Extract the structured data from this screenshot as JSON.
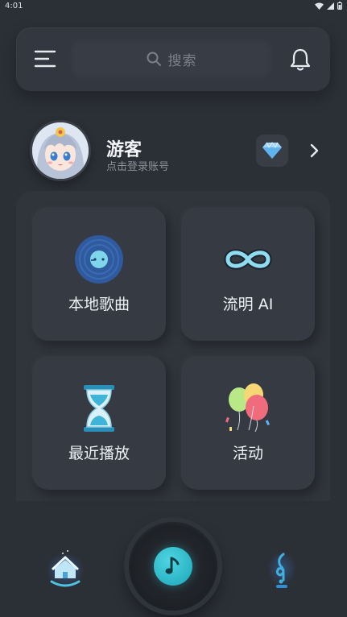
{
  "status_bar": {
    "time": "4:01"
  },
  "header": {
    "search_placeholder": "搜索"
  },
  "profile": {
    "name": "游客",
    "hint": "点击登录账号"
  },
  "tiles": [
    {
      "label": "本地歌曲",
      "icon": "vinyl-disc-icon"
    },
    {
      "label": "流明 AI",
      "icon": "infinity-icon"
    },
    {
      "label": "最近播放",
      "icon": "hourglass-icon"
    },
    {
      "label": "活动",
      "icon": "balloons-icon"
    }
  ],
  "bottom_nav": {
    "items": [
      {
        "icon": "home-icon"
      },
      {
        "icon": "music-note-icon"
      },
      {
        "icon": "treble-clef-icon"
      }
    ]
  },
  "colors": {
    "background": "#2b2f36",
    "accent": "#2cc0d0",
    "card": "#363a42"
  }
}
